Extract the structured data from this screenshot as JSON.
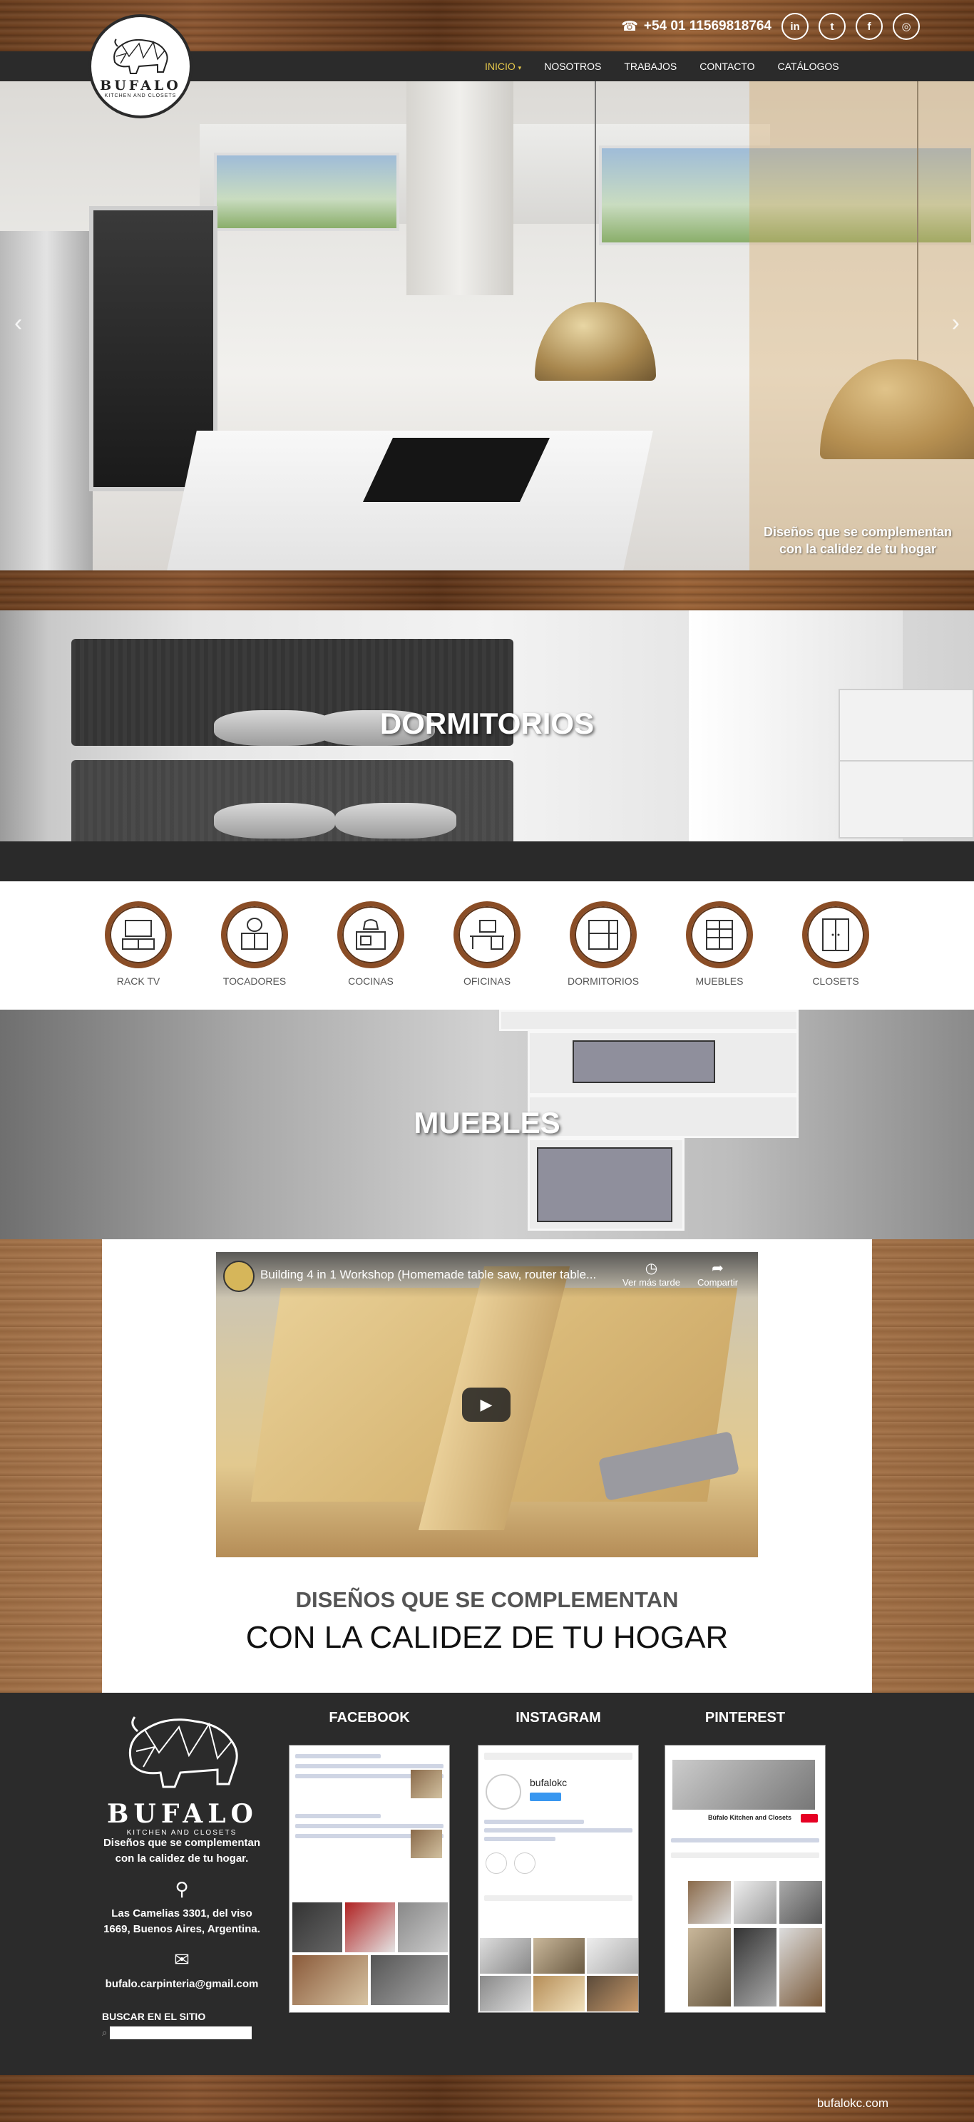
{
  "header": {
    "phone": "+54 01 11569818764",
    "social": [
      {
        "icon": "linkedin-icon",
        "glyph": "in"
      },
      {
        "icon": "twitter-icon",
        "glyph": "t"
      },
      {
        "icon": "facebook-icon",
        "glyph": "f"
      },
      {
        "icon": "instagram-icon",
        "glyph": "◎"
      }
    ],
    "logo_name": "BUFALO",
    "logo_sub": "KITCHEN AND CLOSETS",
    "nav": [
      {
        "label": "INICIO",
        "active": true,
        "dropdown": true
      },
      {
        "label": "NOSOTROS"
      },
      {
        "label": "TRABAJOS"
      },
      {
        "label": "CONTACTO"
      },
      {
        "label": "CATÁLOGOS"
      }
    ]
  },
  "hero": {
    "caption": "Diseños que se complementan con la calidez de tu hogar",
    "prev_arrow": "‹",
    "next_arrow": "›"
  },
  "sections": {
    "dormitorios": "DORMITORIOS",
    "muebles": "MUEBLES"
  },
  "categories": [
    {
      "label": "RACK TV",
      "icon": "tv-rack-icon"
    },
    {
      "label": "TOCADORES",
      "icon": "vanity-icon"
    },
    {
      "label": "COCINAS",
      "icon": "kitchen-icon"
    },
    {
      "label": "OFICINAS",
      "icon": "desk-icon"
    },
    {
      "label": "DORMITORIOS",
      "icon": "bunk-bed-icon"
    },
    {
      "label": "MUEBLES",
      "icon": "dresser-icon"
    },
    {
      "label": "CLOSETS",
      "icon": "closet-icon"
    }
  ],
  "video": {
    "title": "Building 4 in 1 Workshop (Homemade table saw, router table...",
    "watch_later": "Ver más tarde",
    "share": "Compartir",
    "play": "▶"
  },
  "taglines": {
    "line1": "DISEÑOS QUE SE COMPLEMENTAN",
    "line2": "CON LA CALIDEZ DE TU HOGAR"
  },
  "footer": {
    "brand": "BUFALO",
    "brand_sub": "KITCHEN AND CLOSETS",
    "slogan": "Diseños que se complementan con la calidez de tu hogar.",
    "address": "Las Camelias 3301, del viso 1669, Buenos Aires, Argentina.",
    "email": "bufalo.carpinteria@gmail.com",
    "search_label": "BUSCAR EN EL SITIO",
    "search_placeholder": "",
    "social_titles": [
      "FACEBOOK",
      "INSTAGRAM",
      "PINTEREST"
    ],
    "instagram_handle": "bufalokc",
    "pinterest_name": "Búfalo Kitchen and Closets"
  },
  "bottom": {
    "site_url": "bufalokc.com"
  },
  "colors": {
    "nav_bg": "#2b2b2b",
    "nav_active": "#e6c84a",
    "category_ring": "#8a4d26",
    "footer_bg": "#2b2b2b"
  }
}
